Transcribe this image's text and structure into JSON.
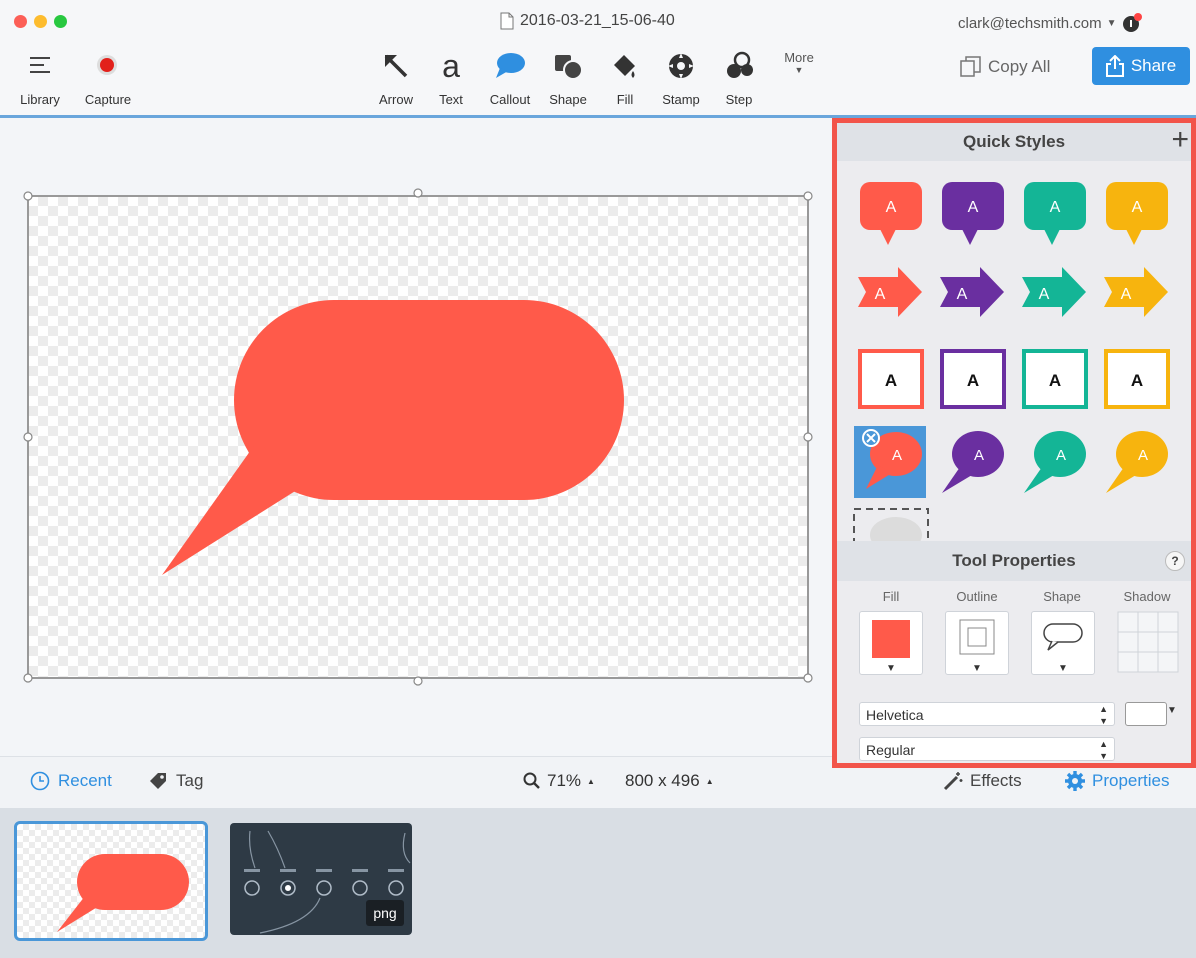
{
  "window": {
    "title": "2016-03-21_15-06-40",
    "account": "clark@techsmith.com"
  },
  "toolbar": {
    "library_label": "Library",
    "capture_label": "Capture",
    "tools": [
      {
        "label": "Arrow",
        "icon": "arrow-icon"
      },
      {
        "label": "Text",
        "icon": "text-icon",
        "glyph": "a"
      },
      {
        "label": "Callout",
        "icon": "callout-icon"
      },
      {
        "label": "Shape",
        "icon": "shape-icon"
      },
      {
        "label": "Fill",
        "icon": "fill-icon"
      },
      {
        "label": "Stamp",
        "icon": "stamp-icon"
      },
      {
        "label": "Step",
        "icon": "step-icon"
      }
    ],
    "more_label": "More",
    "copy_all_label": "Copy All",
    "share_label": "Share"
  },
  "colors": {
    "accent": "#2f8fe0",
    "callout_red": "#ff5a4a",
    "purple": "#6a2fa0",
    "teal": "#14b596",
    "yellow": "#f7b40e",
    "panel_border": "#f2544a"
  },
  "quick_styles": {
    "title": "Quick Styles",
    "add_label": "+",
    "letter": "A"
  },
  "tool_properties": {
    "title": "Tool Properties",
    "help_label": "?",
    "fill_label": "Fill",
    "outline_label": "Outline",
    "shape_label": "Shape",
    "shadow_label": "Shadow",
    "font_family": "Helvetica",
    "font_style": "Regular"
  },
  "statusbar": {
    "recent_label": "Recent",
    "tag_label": "Tag",
    "zoom": "71%",
    "dimensions": "800 x 496",
    "effects_label": "Effects",
    "properties_label": "Properties"
  },
  "tray": {
    "badge": "png"
  }
}
